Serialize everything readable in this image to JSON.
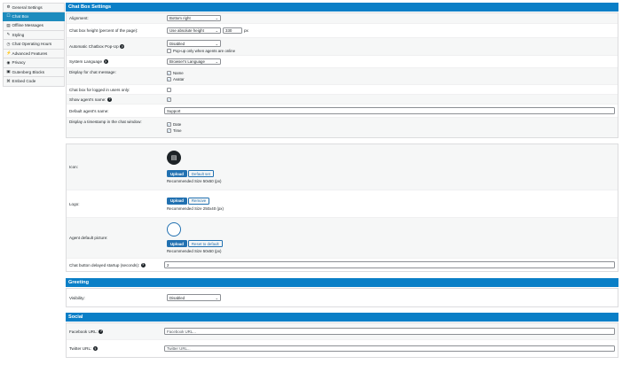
{
  "sidebar": {
    "items": [
      {
        "label": "General Settings",
        "icon": "⚙",
        "active": false
      },
      {
        "label": "Chat Box",
        "icon": "☐",
        "active": true
      },
      {
        "label": "Offline Messages",
        "icon": "▤",
        "active": false
      },
      {
        "label": "Styling",
        "icon": "✎",
        "active": false
      },
      {
        "label": "Chat Operating Hours",
        "icon": "◷",
        "active": false
      },
      {
        "label": "Advanced Features",
        "icon": "⚡",
        "active": false
      },
      {
        "label": "Privacy",
        "icon": "◉",
        "active": false
      },
      {
        "label": "Gutenberg Blocks",
        "icon": "▣",
        "active": false
      },
      {
        "label": "Embed Code",
        "icon": "⌘",
        "active": false
      }
    ]
  },
  "chatbox": {
    "title": "Chat Box Settings",
    "alignment_label": "Alignment:",
    "alignment_value": "Bottom right",
    "height_label": "Chat box height (percent of the page):",
    "height_select": "Use absolute height",
    "height_value": "330",
    "height_unit": "px",
    "popup_label": "Automatic Chatbox Pop-Up",
    "popup_value": "Disabled",
    "popup_only_online": "Pop-up only when agents are online",
    "language_label": "System Language",
    "language_value": "Browser's Language",
    "display_label": "Display for chat message:",
    "display_name": "Name",
    "display_avatar": "Avatar",
    "logged_in_label": "Chat box for logged in users only:",
    "show_agent_label": "Show agent's name:",
    "default_agent_label": "Default agent's name:",
    "default_agent_value": "Support",
    "timestamp_label": "Display a timestamp in the chat window:",
    "timestamp_date": "Date",
    "timestamp_time": "Time"
  },
  "media": {
    "icon_label": "Icon:",
    "upload": "Upload",
    "default_set": "Default set",
    "icon_hint": "Recommended Size 50x50 (px)",
    "logo_label": "Logo:",
    "remove": "Remove",
    "logo_hint": "Recommended Size 250x40 (px)",
    "agent_pic_label": "Agent default picture:",
    "reset_default": "Reset to default",
    "agent_pic_hint": "Recommended Size 50x50 (px)",
    "delay_label": "Chat button delayed startup (seconds):",
    "delay_value": "2"
  },
  "greeting": {
    "title": "Greeting",
    "visibility_label": "Visibility:",
    "visibility_value": "Disabled"
  },
  "social": {
    "title": "Social",
    "facebook_label": "Facebook URL:",
    "facebook_placeholder": "Facebook URL...",
    "twitter_label": "Twitter URL:",
    "twitter_placeholder": "Twitter URL..."
  },
  "colors": {
    "header_blue": "#0a7fc7",
    "active_tab": "#1e8cbe",
    "button_primary": "#2271b1"
  }
}
